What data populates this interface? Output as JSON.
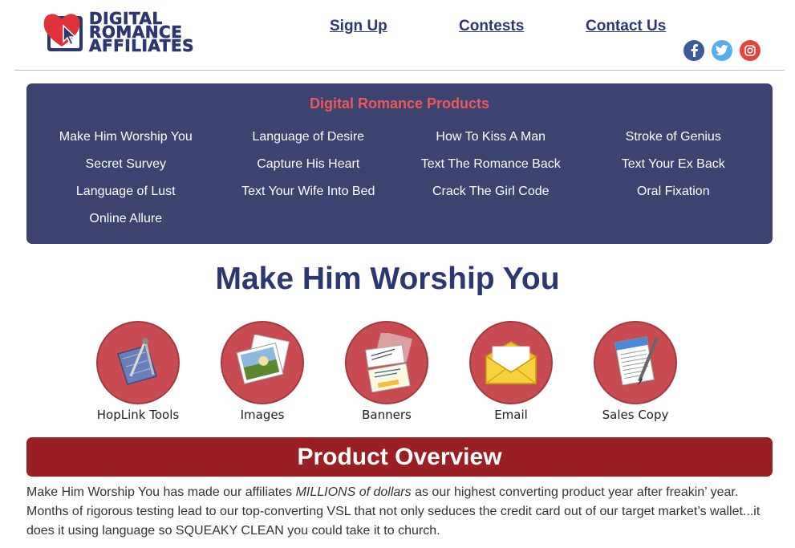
{
  "logo": {
    "line1": "DIGITAL",
    "line2": "ROMANCE",
    "line3": "AFFILIATES"
  },
  "nav": {
    "signup": "Sign Up",
    "contests": "Contests",
    "contact": "Contact Us"
  },
  "social": [
    "facebook-icon",
    "twitter-icon",
    "instagram-icon"
  ],
  "products": {
    "title": "Digital Romance Products",
    "items": [
      "Make Him Worship You",
      "Language of Desire",
      "How To Kiss A Man",
      "Stroke of Genius",
      "Secret Survey",
      "Capture His Heart",
      "Text The Romance Back",
      "Text Your Ex Back",
      "Language of Lust",
      "Text Your Wife Into Bed",
      "Crack The Girl Code",
      "Oral Fixation",
      "Online Allure"
    ]
  },
  "headline": "Make Him Worship You",
  "tools": [
    "HopLink Tools",
    "Images",
    "Banners",
    "Email",
    "Sales Copy"
  ],
  "overview": {
    "title": "Product Overview",
    "text_before": "Make Him Worship You has made our affiliates ",
    "text_em": "MILLIONS of dollars",
    "text_after": " as our highest converting product year after freakin’ year. Months of rigorous testing lead to our top-converting VSL that not only seduces the credit card out of our target market’s wallet...it does it using language so SQUEAKY CLEAN you could take it to church."
  },
  "colors": {
    "navy": "#2c3770",
    "panel": "#3c4371",
    "coral": "#f0575a",
    "maroon": "#9a1f22",
    "tool_circle": "#c84b52"
  }
}
